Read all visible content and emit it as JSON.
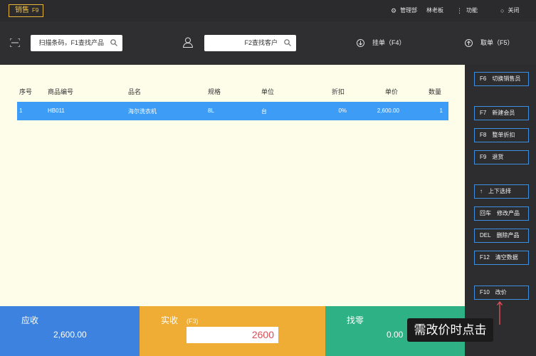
{
  "topbar": {
    "badge_label": "销售",
    "badge_key": "F9",
    "admin": "管理部",
    "user": "林老板",
    "functions": "功能",
    "close": "关闭"
  },
  "searchbar": {
    "product_placeholder": "扫描条码，F1查找产品",
    "customer_placeholder": "F2查找客户",
    "hold_order": "挂单（F4）",
    "fetch_order": "取单（F5）"
  },
  "table": {
    "headers": [
      "序号",
      "商品编号",
      "品名",
      "规格",
      "单位",
      "折扣",
      "单价",
      "数量"
    ],
    "rows": [
      {
        "index": "1",
        "code": "HB011",
        "name": "海尔洗衣机",
        "spec": "8L",
        "unit": "台",
        "discount": "0%",
        "price": "2,600.00",
        "qty": "1"
      }
    ]
  },
  "side_buttons": [
    {
      "key": "F6",
      "label": "切换销售员"
    },
    {
      "key": "F7",
      "label": "新建会员"
    },
    {
      "key": "F8",
      "label": "整单折扣"
    },
    {
      "key": "F9",
      "label": "退货"
    },
    {
      "key": "↑",
      "label": "上下选择"
    },
    {
      "key": "回车",
      "label": "修改产品"
    },
    {
      "key": "DEL",
      "label": "删除产品"
    },
    {
      "key": "F12",
      "label": "清空数据"
    },
    {
      "key": "F10",
      "label": "改价"
    }
  ],
  "bottom": {
    "receivable_label": "应收",
    "receivable_value": "2,600.00",
    "paid_label": "实收",
    "paid_key": "(F3)",
    "paid_value": "2600",
    "change_label": "找零",
    "change_value": "0.00"
  },
  "tooltip": "需改价时点击",
  "colors": {
    "accent_blue": "#3d9cf6",
    "receivable": "#3c82de",
    "paid": "#f0ad35",
    "change": "#2eb184",
    "badge": "#e8b33a"
  }
}
